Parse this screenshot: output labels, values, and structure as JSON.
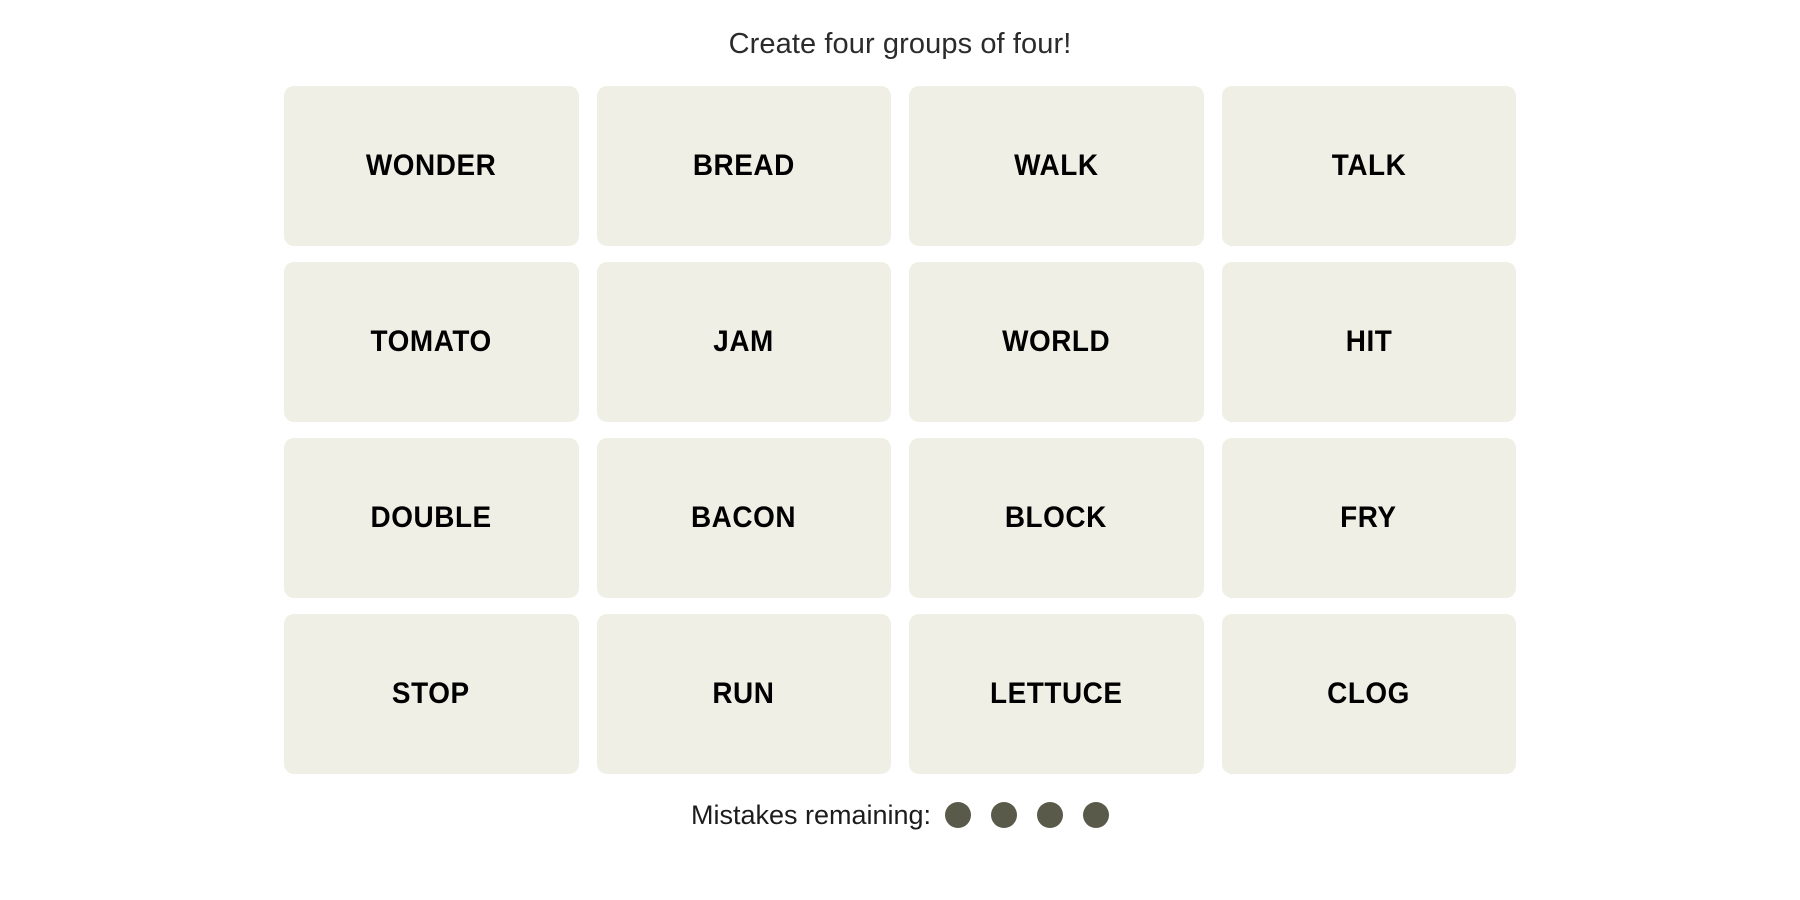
{
  "header": {
    "title": "Create four groups of four!"
  },
  "board": {
    "rows": 4,
    "columns": 4,
    "tiles": [
      {
        "label": "WONDER"
      },
      {
        "label": "BREAD"
      },
      {
        "label": "WALK"
      },
      {
        "label": "TALK"
      },
      {
        "label": "TOMATO"
      },
      {
        "label": "JAM"
      },
      {
        "label": "WORLD"
      },
      {
        "label": "HIT"
      },
      {
        "label": "DOUBLE"
      },
      {
        "label": "BACON"
      },
      {
        "label": "BLOCK"
      },
      {
        "label": "FRY"
      },
      {
        "label": "STOP"
      },
      {
        "label": "RUN"
      },
      {
        "label": "LETTUCE"
      },
      {
        "label": "CLOG"
      }
    ]
  },
  "footer": {
    "mistakes_label": "Mistakes remaining:",
    "mistakes_remaining": 4,
    "dot_color": "#5a5a4b"
  },
  "colors": {
    "page_background": "#ffffff",
    "tile_background": "#efefe6",
    "tile_text": "#000000",
    "title_text": "#2b2b2b"
  }
}
